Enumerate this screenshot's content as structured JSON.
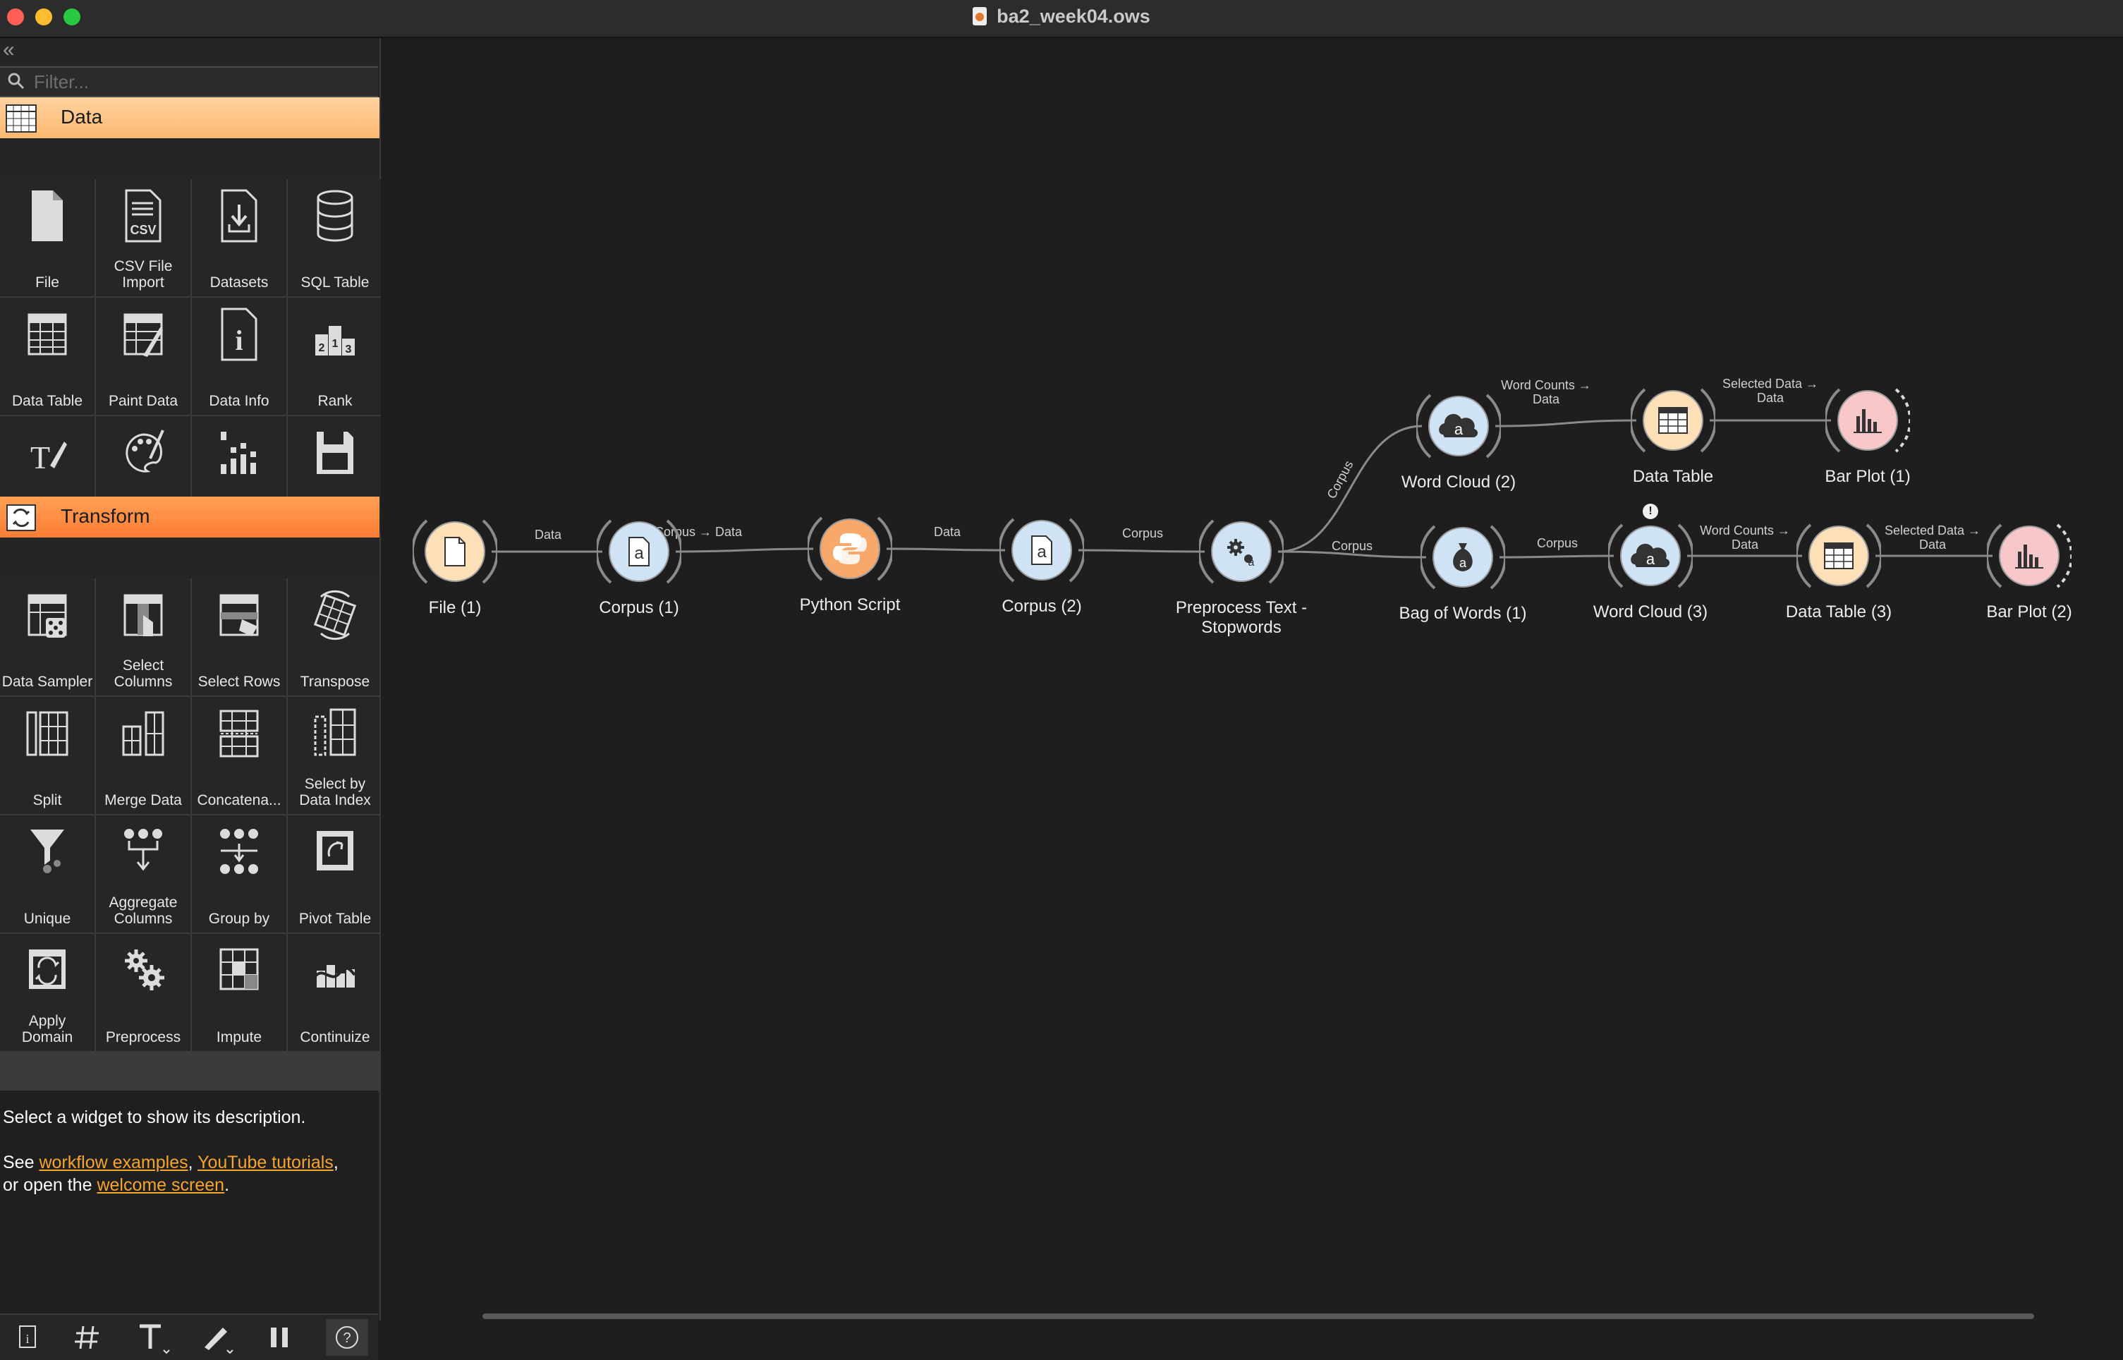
{
  "window": {
    "title": "ba2_week04.ows"
  },
  "sidebar": {
    "filter_placeholder": "Filter...",
    "categories": [
      {
        "label": "Data",
        "widgets": [
          {
            "label": "File",
            "icon": "file-icon"
          },
          {
            "label": "CSV File Import",
            "icon": "csv-icon"
          },
          {
            "label": "Datasets",
            "icon": "datasets-icon"
          },
          {
            "label": "SQL Table",
            "icon": "database-icon"
          },
          {
            "label": "Data Table",
            "icon": "table-icon"
          },
          {
            "label": "Paint Data",
            "icon": "paint-icon"
          },
          {
            "label": "Data Info",
            "icon": "info-icon"
          },
          {
            "label": "Rank",
            "icon": "rank-icon"
          },
          {
            "label": "Edit Domain",
            "icon": "edit-domain-icon"
          },
          {
            "label": "Color",
            "icon": "palette-icon"
          },
          {
            "label": "Column Statistics",
            "icon": "statistics-icon"
          },
          {
            "label": "Save Data",
            "icon": "save-icon"
          }
        ]
      },
      {
        "label": "Transform",
        "widgets": [
          {
            "label": "Data Sampler",
            "icon": "sampler-icon"
          },
          {
            "label": "Select Columns",
            "icon": "select-columns-icon"
          },
          {
            "label": "Select Rows",
            "icon": "select-rows-icon"
          },
          {
            "label": "Transpose",
            "icon": "transpose-icon"
          },
          {
            "label": "Split",
            "icon": "split-icon"
          },
          {
            "label": "Merge Data",
            "icon": "merge-icon"
          },
          {
            "label": "Concatena...",
            "icon": "concatenate-icon"
          },
          {
            "label": "Select by Data Index",
            "icon": "select-index-icon"
          },
          {
            "label": "Unique",
            "icon": "funnel-icon"
          },
          {
            "label": "Aggregate Columns",
            "icon": "aggregate-icon"
          },
          {
            "label": "Group by",
            "icon": "group-by-icon"
          },
          {
            "label": "Pivot Table",
            "icon": "pivot-icon"
          },
          {
            "label": "Apply Domain",
            "icon": "apply-domain-icon"
          },
          {
            "label": "Preprocess",
            "icon": "gears-icon"
          },
          {
            "label": "Impute",
            "icon": "impute-icon"
          },
          {
            "label": "Continuize",
            "icon": "continuize-icon"
          }
        ]
      }
    ],
    "description": {
      "line1": "Select a widget to show its description.",
      "see": "See ",
      "link_examples": "workflow examples",
      "comma": ", ",
      "link_tutorials": "YouTube tutorials",
      "or_open": ",",
      "or_open_2": "or open the ",
      "link_welcome": "welcome screen",
      "period": "."
    },
    "toolbar": [
      {
        "name": "info-button",
        "icon": "info-icon"
      },
      {
        "name": "grid-button",
        "icon": "hash-icon"
      },
      {
        "name": "text-annotation-button",
        "icon": "text-icon"
      },
      {
        "name": "arrow-annotation-button",
        "icon": "pen-icon"
      },
      {
        "name": "pause-button",
        "icon": "pause-icon"
      },
      {
        "name": "help-button",
        "icon": "question-icon"
      }
    ]
  },
  "workflow": {
    "nodes": [
      {
        "id": "file1",
        "label": "File (1)",
        "color": "#fde0b8",
        "icon": "file-icon"
      },
      {
        "id": "corpus1",
        "label": "Corpus (1)",
        "color": "#cfe3f5",
        "icon": "corpus-icon"
      },
      {
        "id": "python",
        "label": "Python Script",
        "color": "#f7a86a",
        "icon": "python-icon"
      },
      {
        "id": "corpus2",
        "label": "Corpus (2)",
        "color": "#cfe3f5",
        "icon": "corpus-icon"
      },
      {
        "id": "preprocess",
        "label": "Preprocess Text - Stopwords",
        "color": "#cfe3f5",
        "icon": "gears-icon"
      },
      {
        "id": "wordcloud2",
        "label": "Word Cloud (2)",
        "color": "#cfe3f5",
        "icon": "cloud-icon"
      },
      {
        "id": "datatable",
        "label": "Data Table",
        "color": "#fde0b8",
        "icon": "table-icon"
      },
      {
        "id": "barplot1",
        "label": "Bar Plot (1)",
        "color": "#f7c7c9",
        "icon": "bar-chart-icon"
      },
      {
        "id": "bow1",
        "label": "Bag of Words (1)",
        "color": "#cfe3f5",
        "icon": "bag-icon"
      },
      {
        "id": "wordcloud3",
        "label": "Word Cloud (3)",
        "color": "#cfe3f5",
        "icon": "cloud-icon"
      },
      {
        "id": "datatable3",
        "label": "Data Table (3)",
        "color": "#fde0b8",
        "icon": "table-icon"
      },
      {
        "id": "barplot2",
        "label": "Bar Plot (2)",
        "color": "#f7c7c9",
        "icon": "bar-chart-icon"
      }
    ],
    "links": [
      {
        "label": "Data"
      },
      {
        "label": "Corpus → Data"
      },
      {
        "label": "Data"
      },
      {
        "label": "Corpus"
      },
      {
        "label": "Corpus"
      },
      {
        "label": "Word Counts → Data"
      },
      {
        "label": "Selected Data → Data"
      },
      {
        "label": "Corpus"
      },
      {
        "label": "Corpus"
      },
      {
        "label": "Word Counts → Data"
      },
      {
        "label": "Selected Data → Data"
      }
    ],
    "warning_badge": "!"
  }
}
